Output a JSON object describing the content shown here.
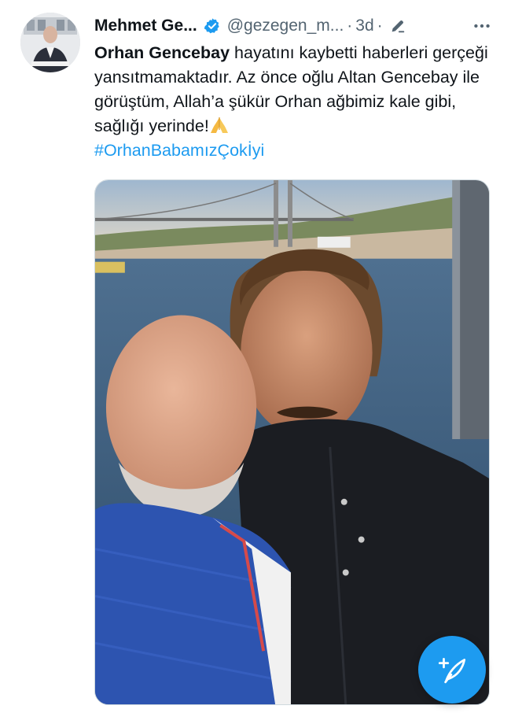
{
  "author": {
    "name": "Mehmet Ge...",
    "handle": "@gezegen_m...",
    "time": "3d",
    "separator": "·",
    "avatar_icon": "user-avatar",
    "verified_icon": "verified-badge-icon"
  },
  "tweet": {
    "bold_lead": "Orhan Gencebay",
    "text": " hayatını kaybetti haberleri gerçeği yansıtmamaktadır. Az önce oğlu Altan Gencebay ile görüştüm, Allah’a şükür Orhan ağbimiz kale gibi, sağlığı yerinde!",
    "emoji": "folded-hands-emoji",
    "hashtag": "#OrhanBabamızÇokİyi"
  },
  "media": {
    "type": "photo",
    "description_icon": "selfie-photo"
  },
  "actions": {
    "more_icon": "more-horizontal-icon",
    "edit_icon": "edit-pencil-icon",
    "compose_icon": "compose-tweet-icon"
  },
  "colors": {
    "accent": "#1d9bf0",
    "text_primary": "#0f1419",
    "text_secondary": "#536471"
  }
}
